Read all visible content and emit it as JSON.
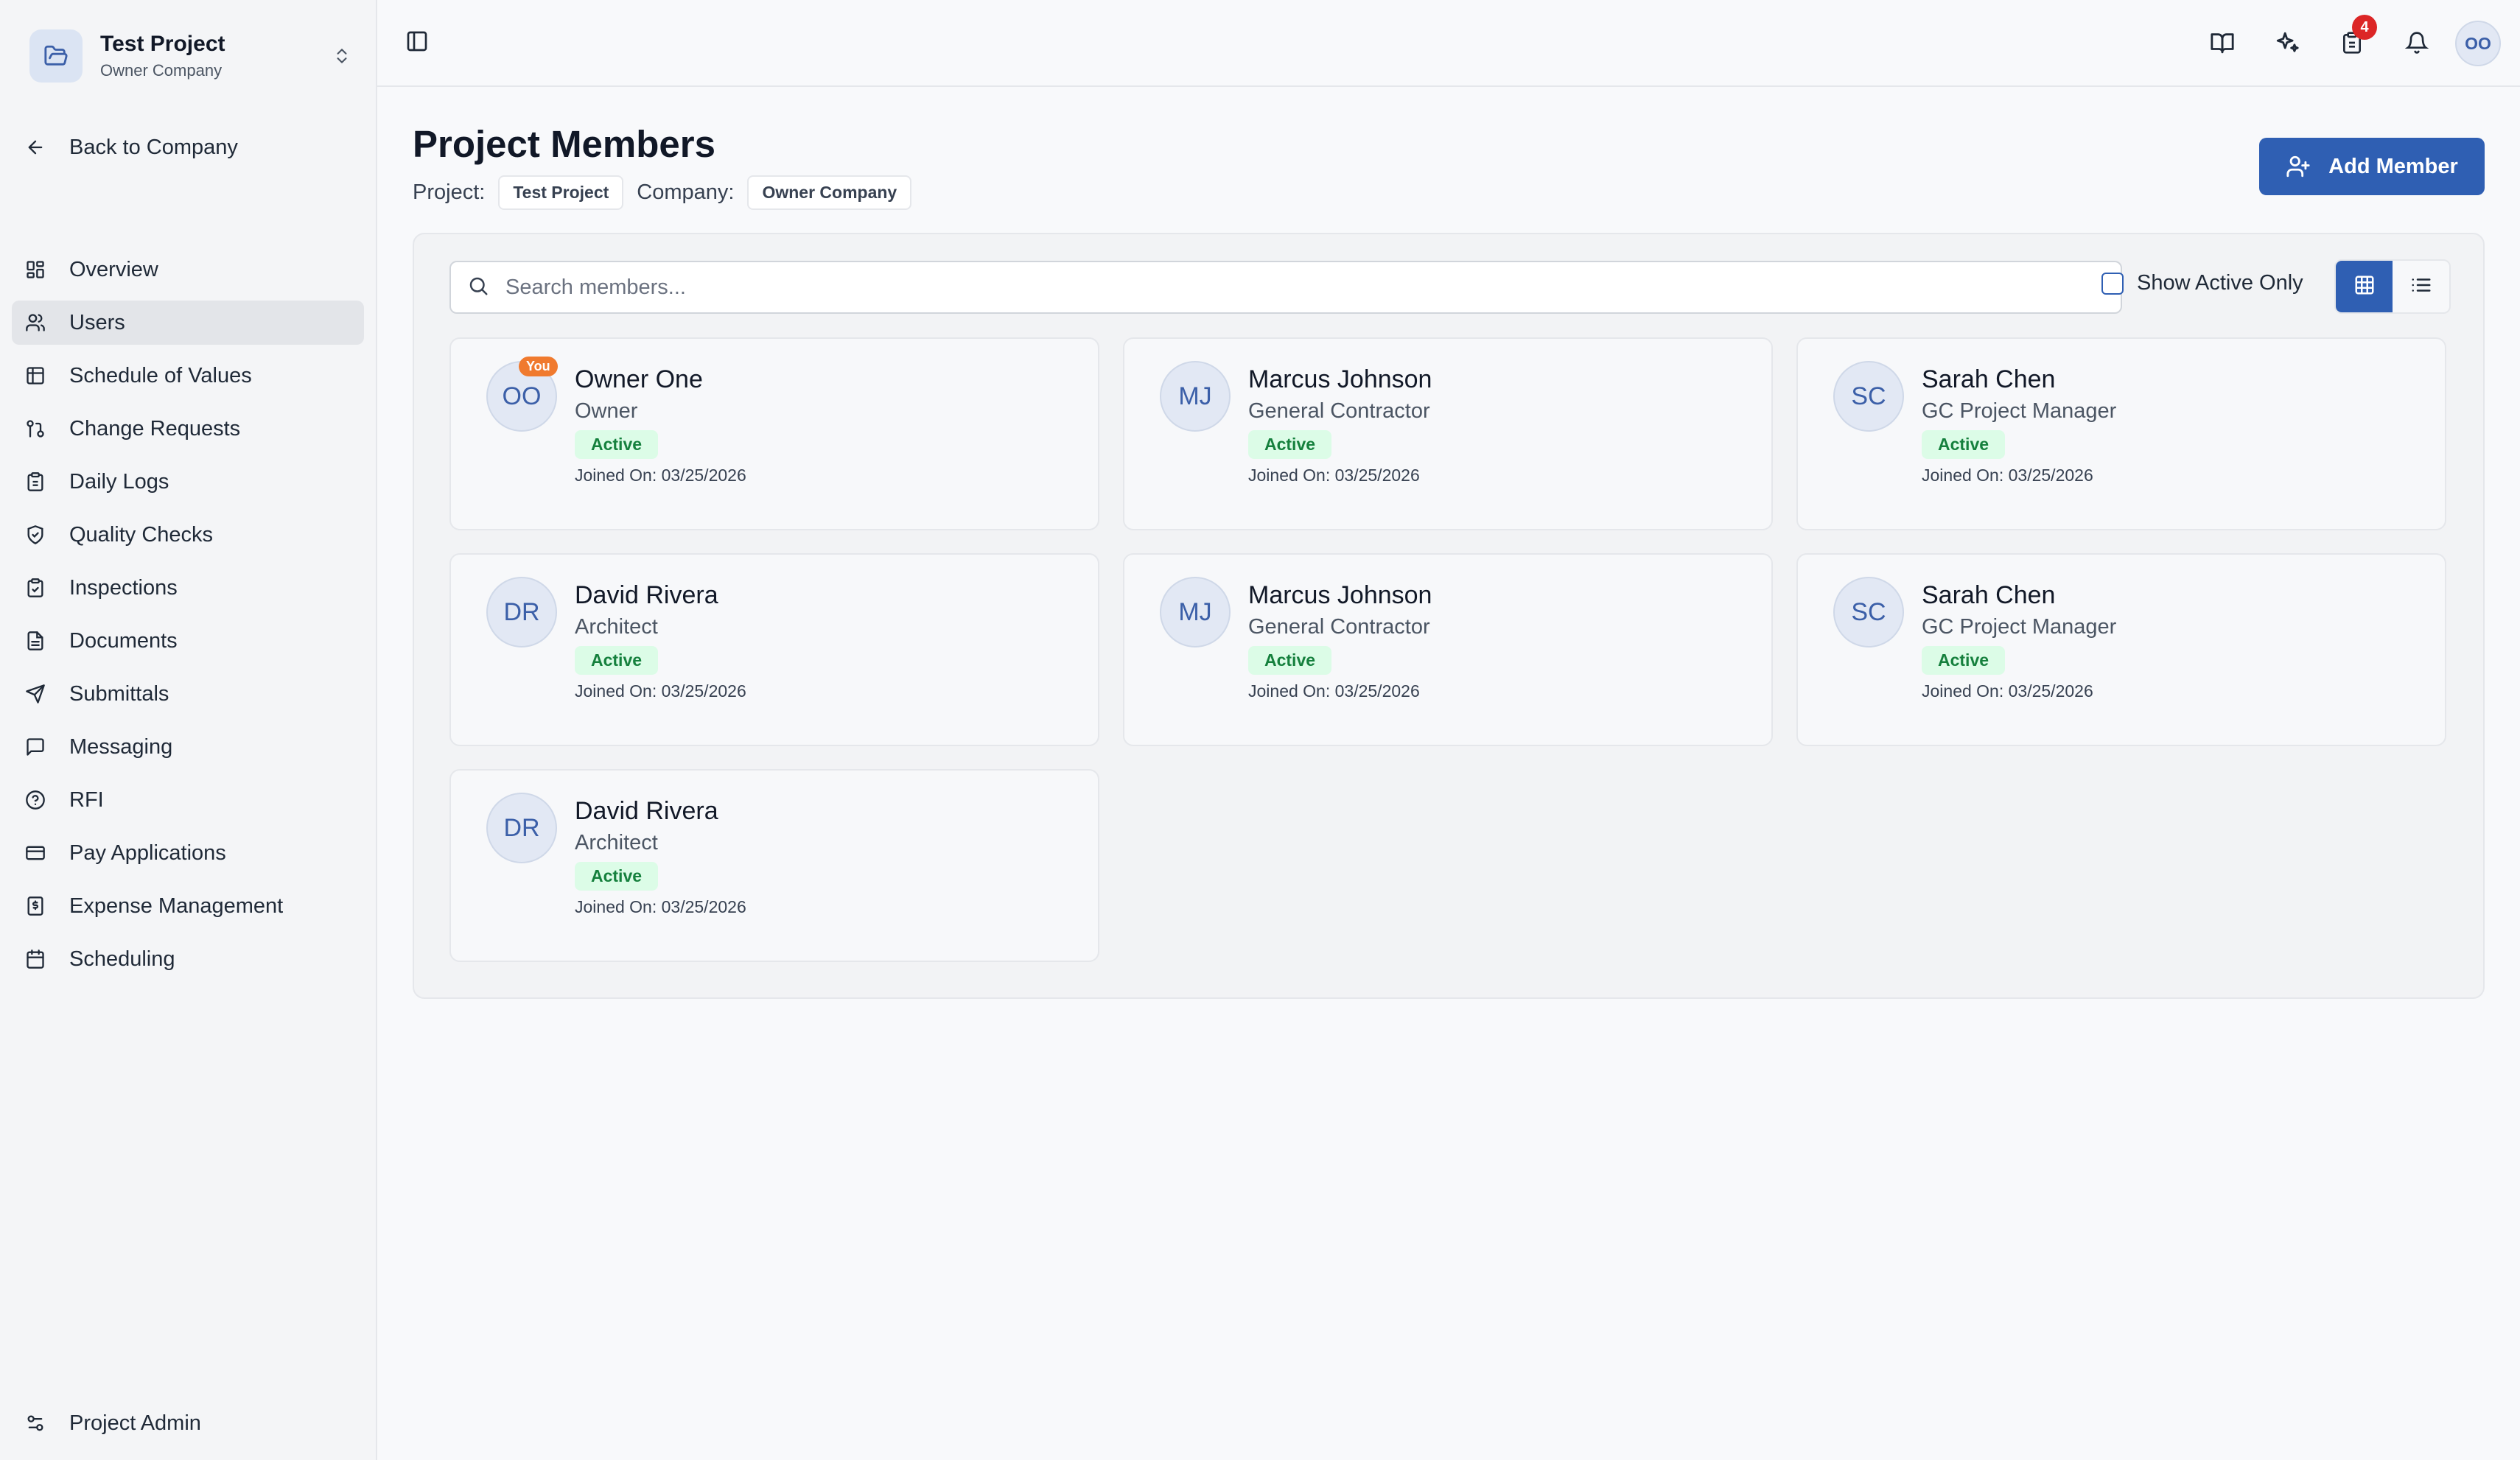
{
  "project": {
    "name": "Test Project",
    "company": "Owner Company"
  },
  "sidebar": {
    "back_label": "Back to Company",
    "items": [
      {
        "label": "Overview",
        "icon": "overview-icon"
      },
      {
        "label": "Users",
        "icon": "users-icon",
        "active": true
      },
      {
        "label": "Schedule of Values",
        "icon": "table-icon"
      },
      {
        "label": "Change Requests",
        "icon": "git-pull-icon"
      },
      {
        "label": "Daily Logs",
        "icon": "clipboard-icon"
      },
      {
        "label": "Quality Checks",
        "icon": "shield-check-icon"
      },
      {
        "label": "Inspections",
        "icon": "clipboard-check-icon"
      },
      {
        "label": "Documents",
        "icon": "document-icon"
      },
      {
        "label": "Submittals",
        "icon": "send-icon"
      },
      {
        "label": "Messaging",
        "icon": "message-icon"
      },
      {
        "label": "RFI",
        "icon": "help-circle-icon"
      },
      {
        "label": "Pay Applications",
        "icon": "credit-card-icon"
      },
      {
        "label": "Expense Management",
        "icon": "receipt-icon"
      },
      {
        "label": "Scheduling",
        "icon": "calendar-icon"
      }
    ],
    "admin_label": "Project Admin"
  },
  "topbar": {
    "tasks_badge": "4",
    "user_initials": "OO"
  },
  "page": {
    "title": "Project Members",
    "project_label": "Project:",
    "project_value": "Test Project",
    "company_label": "Company:",
    "company_value": "Owner Company",
    "add_button": "Add Member"
  },
  "filters": {
    "search_placeholder": "Search members...",
    "active_only_label": "Show Active Only",
    "active_only_checked": false,
    "view": "grid"
  },
  "members": [
    {
      "initials": "OO",
      "name": "Owner One",
      "role": "Owner",
      "status": "Active",
      "joined": "Joined On: 03/25/2026",
      "you": "You"
    },
    {
      "initials": "MJ",
      "name": "Marcus Johnson",
      "role": "General Contractor",
      "status": "Active",
      "joined": "Joined On: 03/25/2026"
    },
    {
      "initials": "SC",
      "name": "Sarah Chen",
      "role": "GC Project Manager",
      "status": "Active",
      "joined": "Joined On: 03/25/2026"
    },
    {
      "initials": "DR",
      "name": "David Rivera",
      "role": "Architect",
      "status": "Active",
      "joined": "Joined On: 03/25/2026"
    },
    {
      "initials": "MJ",
      "name": "Marcus Johnson",
      "role": "General Contractor",
      "status": "Active",
      "joined": "Joined On: 03/25/2026"
    },
    {
      "initials": "SC",
      "name": "Sarah Chen",
      "role": "GC Project Manager",
      "status": "Active",
      "joined": "Joined On: 03/25/2026"
    },
    {
      "initials": "DR",
      "name": "David Rivera",
      "role": "Architect",
      "status": "Active",
      "joined": "Joined On: 03/25/2026"
    }
  ],
  "colors": {
    "accent": "#2f5fb3",
    "active_bg": "#dcfce7",
    "active_text": "#15803d",
    "you_badge": "#f07a2e",
    "notification": "#dc2626"
  }
}
